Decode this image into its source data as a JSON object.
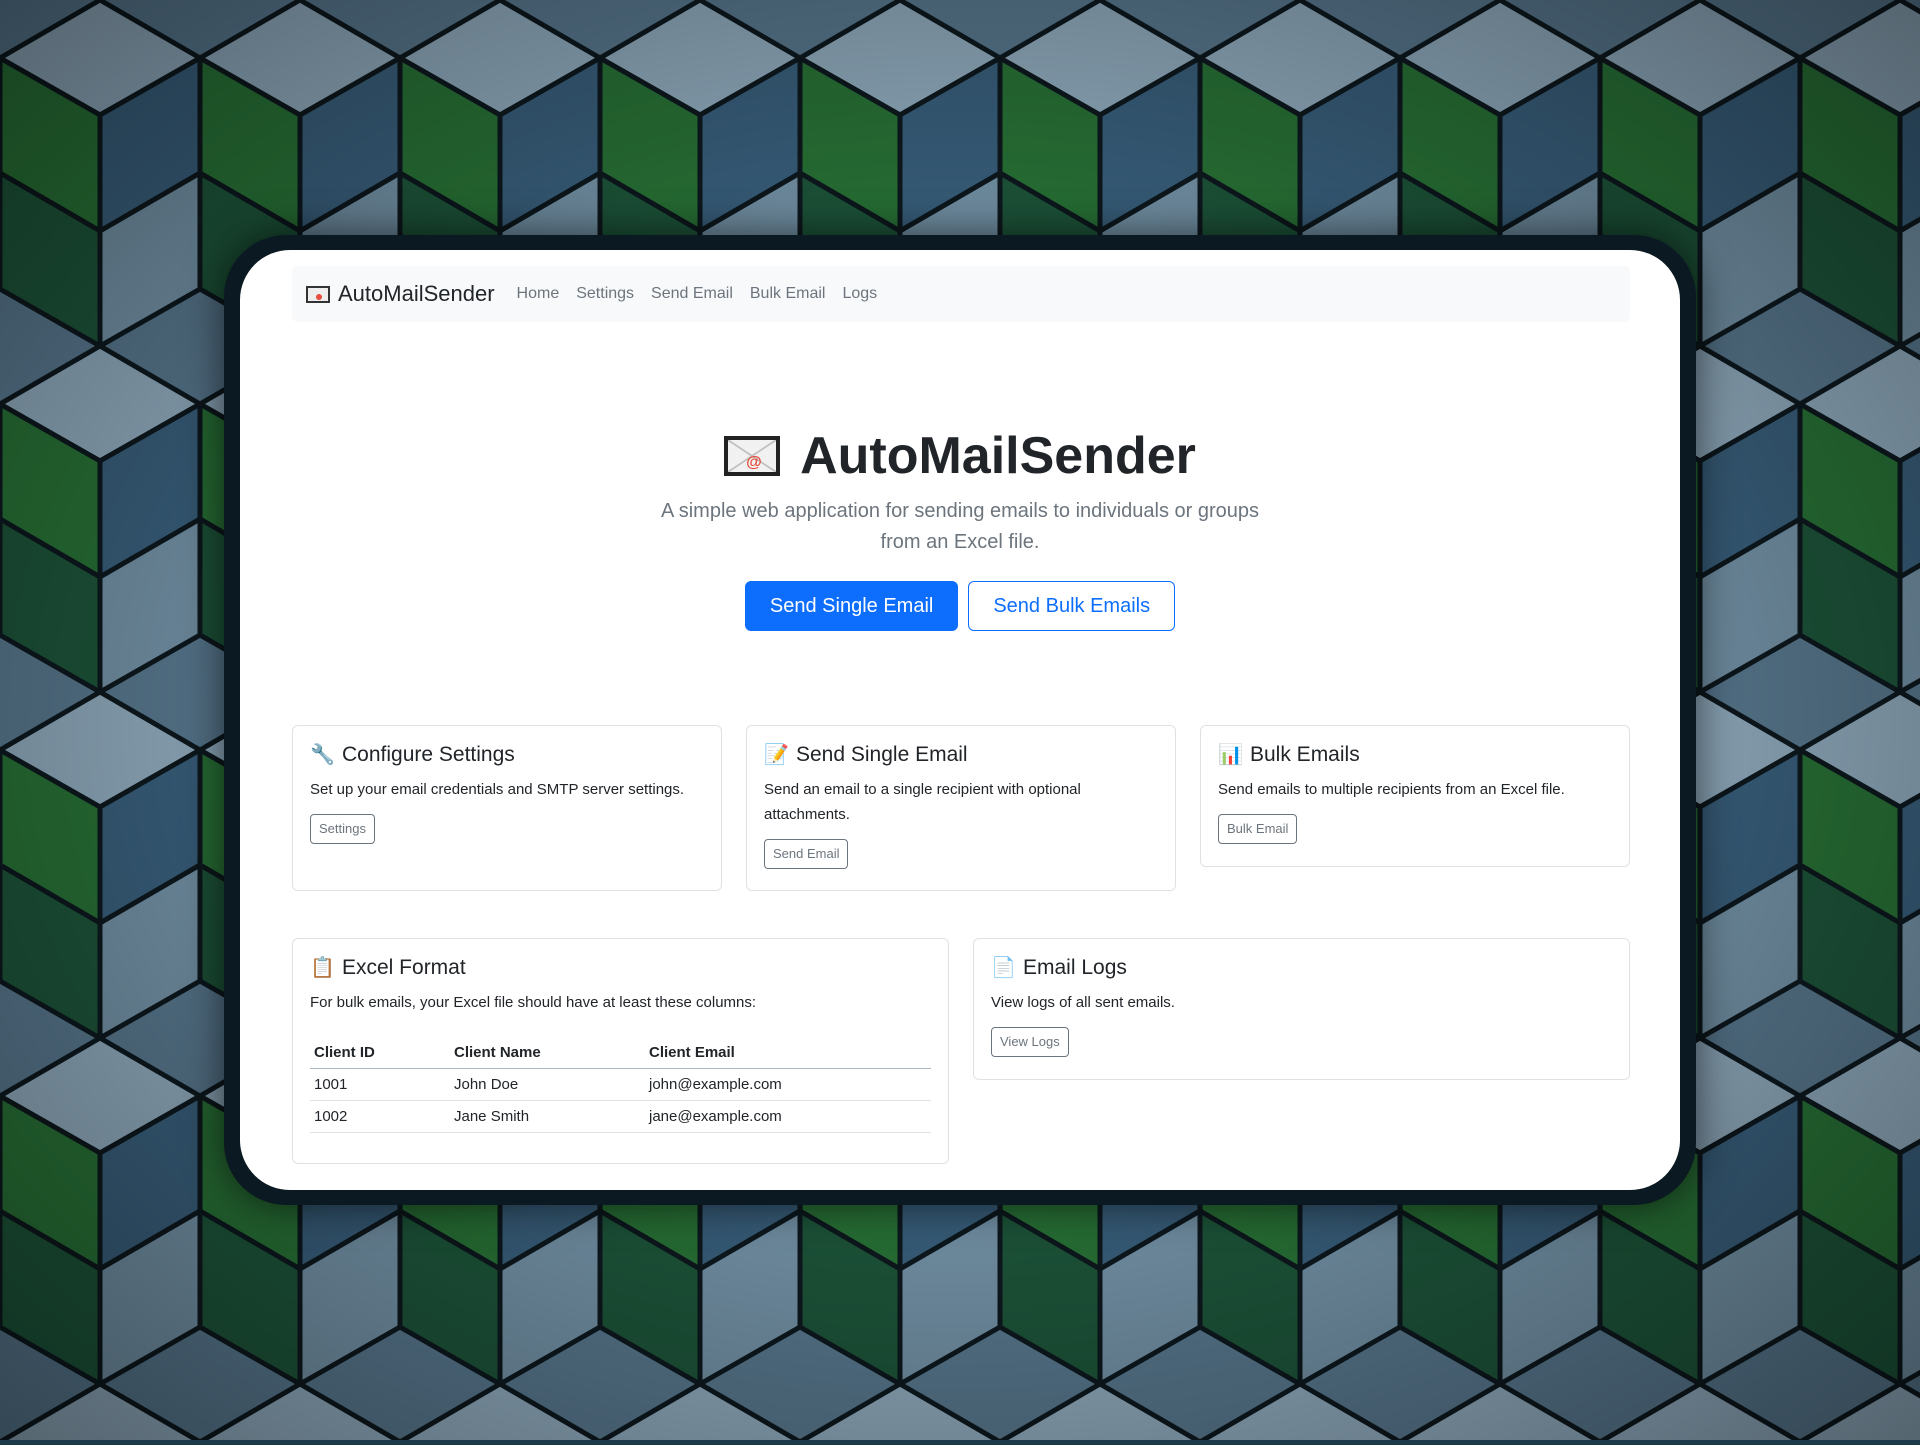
{
  "navbar": {
    "brand": "AutoMailSender",
    "links": [
      "Home",
      "Settings",
      "Send Email",
      "Bulk Email",
      "Logs"
    ]
  },
  "hero": {
    "title": "AutoMailSender",
    "subtitle": "A simple web application for sending emails to individuals or groups from an Excel file.",
    "primary_button": "Send Single Email",
    "secondary_button": "Send Bulk Emails"
  },
  "cards": [
    {
      "title": "Configure Settings",
      "icon": "wrench-icon",
      "text": "Set up your email credentials and SMTP server settings.",
      "button": "Settings"
    },
    {
      "title": "Send Single Email",
      "icon": "memo-icon",
      "text": "Send an email to a single recipient with optional attachments.",
      "button": "Send Email"
    },
    {
      "title": "Bulk Emails",
      "icon": "bar-chart-icon",
      "text": "Send emails to multiple recipients from an Excel file.",
      "button": "Bulk Email"
    }
  ],
  "excel": {
    "title": "Excel Format",
    "icon": "clipboard-icon",
    "text": "For bulk emails, your Excel file should have at least these columns:",
    "headers": [
      "Client ID",
      "Client Name",
      "Client Email"
    ],
    "rows": [
      [
        "1001",
        "John Doe",
        "john@example.com"
      ],
      [
        "1002",
        "Jane Smith",
        "jane@example.com"
      ]
    ]
  },
  "logs": {
    "title": "Email Logs",
    "icon": "page-icon",
    "text": "View logs of all sent emails.",
    "button": "View Logs"
  },
  "colors": {
    "primary": "#0d6efd",
    "secondary": "#6c757d",
    "navbar_bg": "#f8f9fa"
  }
}
